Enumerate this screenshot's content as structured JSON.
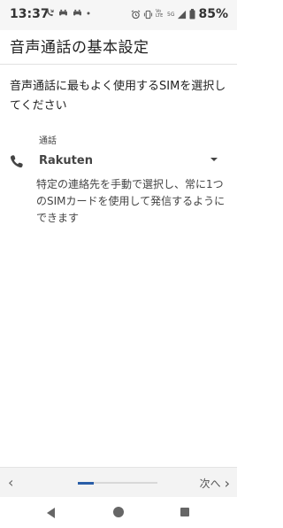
{
  "status_bar": {
    "time": "13:37",
    "battery_percent": "85%",
    "volte_label": "Vo LTE",
    "network_label": "5G",
    "left_icons": [
      "missed-call-icon",
      "game-icon",
      "game-icon",
      "dot-icon"
    ],
    "right_icons": [
      "alarm-icon",
      "vibrate-icon",
      "signal-icon",
      "battery-icon"
    ]
  },
  "header": {
    "title": "音声通話の基本設定"
  },
  "main": {
    "instruction": "音声通話に最もよく使用するSIMを選択してください",
    "call_section": {
      "label": "通話",
      "icon": "phone-icon",
      "selected_sim": "Rakuten",
      "description": "特定の連絡先を手動で選択し、常に1つのSIMカードを使用して発信するようにできます"
    }
  },
  "wizard": {
    "back_icon": "chevron-left-icon",
    "next_label": "次へ",
    "next_icon": "chevron-right-icon",
    "progress_fraction": 0.2,
    "accent_color": "#2a5ea8"
  },
  "nav_bar": {
    "icons": [
      "nav-back-icon",
      "nav-home-icon",
      "nav-recents-icon"
    ]
  }
}
